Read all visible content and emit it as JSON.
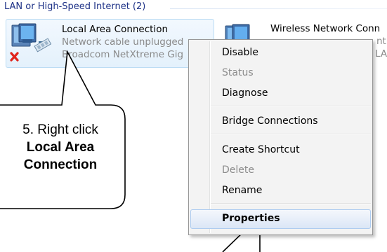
{
  "group": {
    "title": "LAN or High-Speed Internet (2)"
  },
  "connections": [
    {
      "name": "Local Area Connection",
      "status": "Network cable unplugged",
      "device": "Broadcom NetXtreme Gig",
      "icon": "network-adapter-disconnected-icon"
    },
    {
      "name": "Wireless Network Conn",
      "status": "nti",
      "device": "LA",
      "icon": "wireless-adapter-icon"
    }
  ],
  "context_menu": {
    "items": [
      {
        "label": "Disable",
        "enabled": true
      },
      {
        "label": "Status",
        "enabled": false
      },
      {
        "label": "Diagnose",
        "enabled": true
      },
      {
        "label": "Bridge Connections",
        "enabled": true
      },
      {
        "label": "Create Shortcut",
        "enabled": true
      },
      {
        "label": "Delete",
        "enabled": false
      },
      {
        "label": "Rename",
        "enabled": true
      },
      {
        "label": "Properties",
        "enabled": true,
        "default": true,
        "hovered": true
      }
    ]
  },
  "callout": {
    "line1": "5. Right click",
    "line2": "Local Area",
    "line3": "Connection"
  },
  "colors": {
    "group_title": "#1e3287",
    "selection_border": "#bcdcf4",
    "menu_background": "#f3f3f3",
    "disabled_text": "#8d8d8d"
  }
}
